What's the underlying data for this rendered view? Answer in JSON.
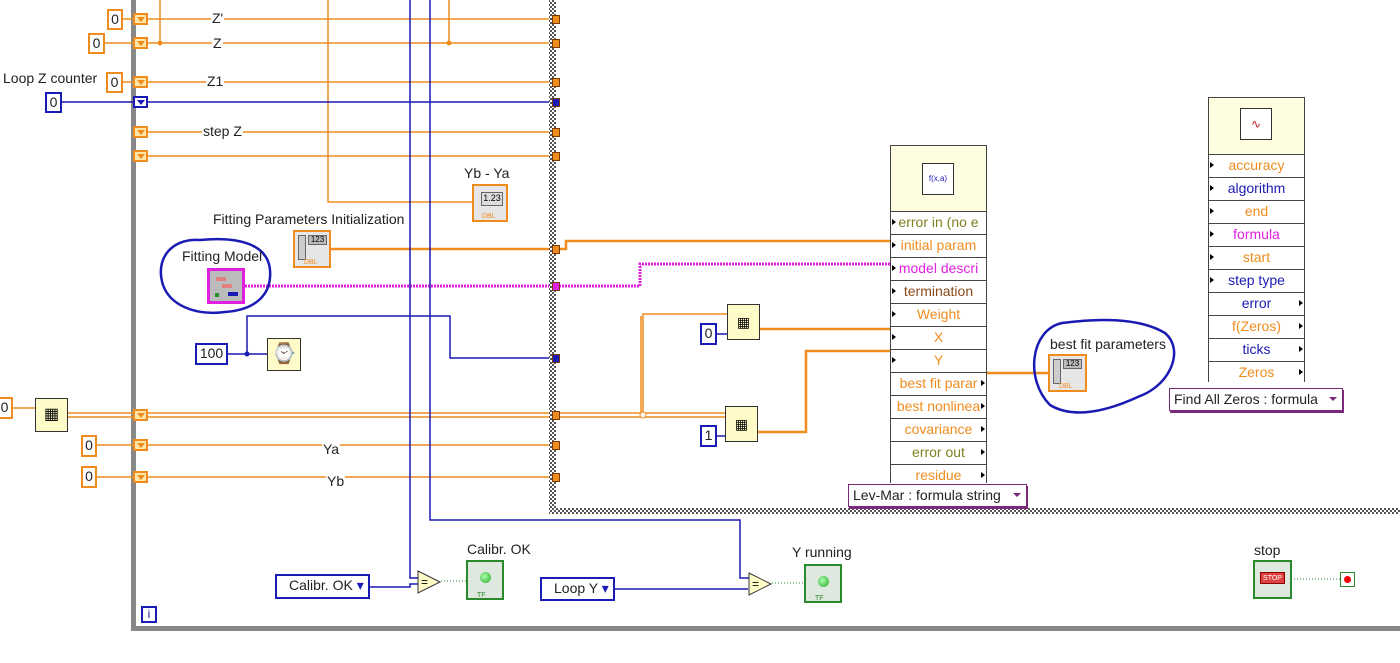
{
  "labels": {
    "z_prime": "Z'",
    "z": "Z",
    "loop_z_counter": "Loop Z counter",
    "z1": "Z1",
    "step_z": "step Z",
    "yb_ya": "Yb - Ya",
    "fit_init": "Fitting Parameters Initialization",
    "fit_model": "Fitting Model",
    "ya": "Ya",
    "yb": "Yb",
    "calibr_ok": "Calibr. OK",
    "y_running": "Y running",
    "stop": "stop",
    "best_fit": "best fit parameters"
  },
  "constants": {
    "z_prime": "0",
    "z": "0",
    "z1": "0",
    "loop_z": "0",
    "wait_ms": "100",
    "left_array": "0",
    "ya": "0",
    "yb": "0",
    "index_x": "0",
    "index_y": "1"
  },
  "indicators": {
    "numeric": "1.23",
    "array": "123",
    "dbl": "DBL",
    "stop_text": "STOP",
    "iteration": "i"
  },
  "levmar": {
    "terminals": [
      {
        "label": "error in (no e",
        "color": "#808020"
      },
      {
        "label": "initial param",
        "color": "#f08c1e"
      },
      {
        "label": "model descri",
        "color": "#e020e0"
      },
      {
        "label": "termination",
        "color": "#8a4a1a"
      },
      {
        "label": "Weight",
        "color": "#f08c1e"
      },
      {
        "label": "X",
        "color": "#f08c1e"
      },
      {
        "label": "Y",
        "color": "#f08c1e"
      },
      {
        "label": "best fit parar",
        "color": "#f08c1e"
      },
      {
        "label": "best nonlinea",
        "color": "#f08c1e"
      },
      {
        "label": "covariance",
        "color": "#f08c1e"
      },
      {
        "label": "error out",
        "color": "#808020"
      },
      {
        "label": "residue",
        "color": "#f08c1e"
      }
    ],
    "selector": "Lev-Mar : formula string"
  },
  "zeros": {
    "terminals": [
      {
        "label": "accuracy",
        "color": "#f08c1e"
      },
      {
        "label": "algorithm",
        "color": "#1a1ab4"
      },
      {
        "label": "end",
        "color": "#f08c1e"
      },
      {
        "label": "formula",
        "color": "#e020e0"
      },
      {
        "label": "start",
        "color": "#f08c1e"
      },
      {
        "label": "step type",
        "color": "#1a1ab4"
      },
      {
        "label": "error",
        "color": "#1a1ab4"
      },
      {
        "label": "f(Zeros)",
        "color": "#f08c1e"
      },
      {
        "label": "ticks",
        "color": "#1a1ab4"
      },
      {
        "label": "Zeros",
        "color": "#f08c1e"
      }
    ],
    "selector": "Find All Zeros : formula"
  },
  "enums": {
    "calibr_ok": "Calibr. OK",
    "loop_y": "Loop Y"
  },
  "colors": {
    "orange": "#f08c1e",
    "blue": "#1a1ab4",
    "magenta": "#e020e0",
    "green": "#2a8a2a",
    "annotation": "#1a1ab4"
  }
}
